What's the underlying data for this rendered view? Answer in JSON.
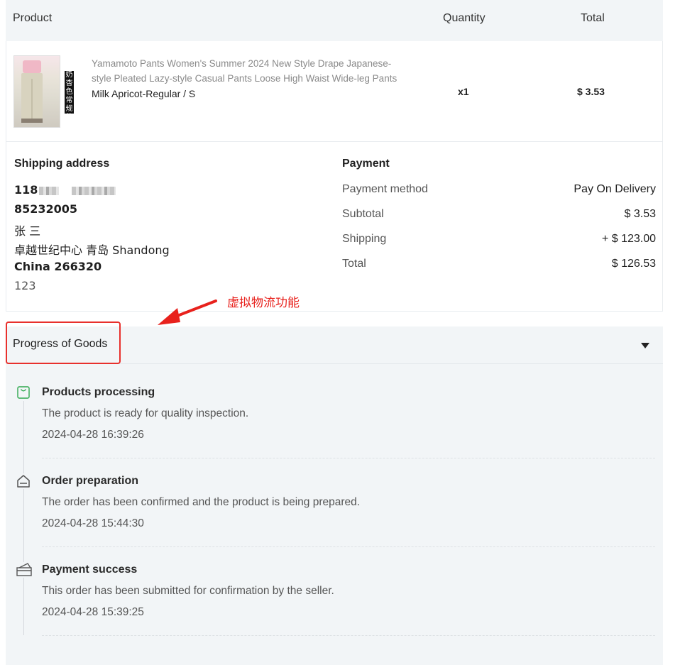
{
  "table_header": {
    "product": "Product",
    "quantity": "Quantity",
    "total": "Total"
  },
  "product": {
    "title": "Yamamoto Pants Women's Summer 2024 New Style Drape Japanese-style Pleated Lazy-style Casual Pants Loose High Waist Wide-leg Pants",
    "variant": "Milk Apricot-Regular / S",
    "quantity": "x1",
    "price": "$ 3.53",
    "image_label": "奶杏色常规款"
  },
  "shipping": {
    "title": "Shipping address",
    "phone_partial": "118",
    "postal_code_line": "85232005",
    "name": "张 三",
    "address_line": "卓越世纪中心 青岛 Shandong",
    "country_line": "China 266320",
    "note": "123"
  },
  "payment": {
    "title": "Payment",
    "rows": [
      {
        "label": "Payment method",
        "value": "Pay On Delivery"
      },
      {
        "label": "Subtotal",
        "value": "$ 3.53"
      },
      {
        "label": "Shipping",
        "value": "+ $ 123.00"
      },
      {
        "label": "Total",
        "value": "$ 126.53"
      }
    ]
  },
  "annotation": {
    "text": "虚拟物流功能",
    "color": "#e8211c"
  },
  "progress": {
    "title": "Progress of Goods",
    "steps": [
      {
        "icon": "shopping-bag-icon",
        "title": "Products processing",
        "description": "The product is ready for quality inspection.",
        "time": "2024-04-28 16:39:26",
        "color": "#2fa84f"
      },
      {
        "icon": "house-icon",
        "title": "Order preparation",
        "description": "The order has been confirmed and the product is being prepared.",
        "time": "2024-04-28 15:44:30",
        "color": "#555555"
      },
      {
        "icon": "payment-card-icon",
        "title": "Payment success",
        "description": "This order has been submitted for confirmation by the seller.",
        "time": "2024-04-28 15:39:25",
        "color": "#555555"
      }
    ]
  }
}
